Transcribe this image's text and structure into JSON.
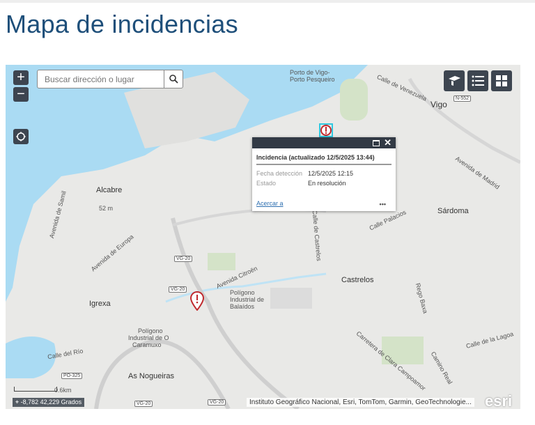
{
  "page_title": "Mapa de incidencias",
  "search": {
    "placeholder": "Buscar dirección o lugar"
  },
  "controls": {
    "zoom_in": "+",
    "zoom_out": "−"
  },
  "popup": {
    "title": "Incidencia (actualizado 12/5/2025 13:44)",
    "fields": [
      {
        "label": "Fecha detección",
        "value": "12/5/2025 12:15"
      },
      {
        "label": "Estado",
        "value": "En resolución"
      }
    ],
    "zoom_link": "Acercar a",
    "more": "•••"
  },
  "map": {
    "labels": {
      "porto": "Porto de Vigo-",
      "porto2": "Porto Pesqueiro",
      "venezuela": "Calle de Venezuela",
      "vigo": "Vigo",
      "alcabre": "Alcabre",
      "alt": "52 m",
      "samil": "Avenida de Samil",
      "europa": "Avenida de Europa",
      "sardoma": "Sárdoma",
      "madrid": "Avenida de Madrid",
      "castrelos": "Castrelos",
      "calle_castrelos": "Calle de Castrelos",
      "igrexa": "Igrexa",
      "balaidos": "Polígono",
      "balaidos2": "Industrial de",
      "balaidos3": "Balaídos",
      "caramuxo": "Polígono",
      "caramuxo2": "Industrial de O",
      "caramuxo3": "Caramuxo",
      "nogueiras": "As Nogueiras",
      "rio": "Calle del Río",
      "rego": "Rego Baxa",
      "campoamor": "Carretera de Clara Campoamor",
      "camino": "Camino Real",
      "citroen": "Avenida Citroën",
      "lagoa": "Calle de la Lagoa",
      "palacios": "Calle Palacios"
    },
    "shields": {
      "n552": "N-552",
      "vg20a": "VG-20",
      "vg20b": "VG-20",
      "vg20c": "VG-20",
      "vg20d": "VG-20",
      "po325": "PO-325"
    },
    "scale": "0.6km",
    "coordinates": "-8,782 42,229 Grados",
    "attribution": "Instituto Geográfico Nacional, Esri, TomTom, Garmin, GeoTechnologie...",
    "logo": "esri"
  },
  "colors": {
    "water": "#aadbf3",
    "land": "#e9e9e7",
    "title": "#1e4f7a",
    "marker": "#c0282d"
  }
}
